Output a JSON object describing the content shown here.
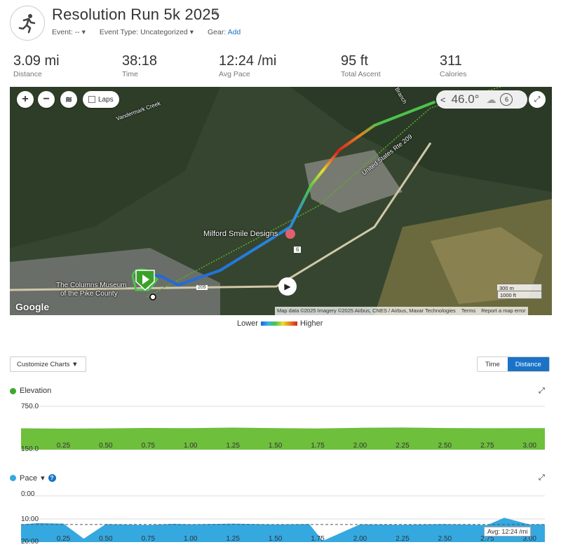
{
  "header": {
    "title": "Resolution Run 5k 2025",
    "event_label": "Event: --",
    "event_type_label": "Event Type: Uncategorized",
    "gear_label": "Gear:",
    "gear_link": "Add"
  },
  "stats": [
    {
      "value": "3.09 mi",
      "label": "Distance"
    },
    {
      "value": "38:18",
      "label": "Time"
    },
    {
      "value": "12:24 /mi",
      "label": "Avg Pace"
    },
    {
      "value": "95 ft",
      "label": "Total Ascent"
    },
    {
      "value": "311",
      "label": "Calories"
    }
  ],
  "map": {
    "laps_label": "Laps",
    "weather_temp": "46.0°",
    "weather_wind": "6",
    "labels": {
      "poi": "Milford Smile Designs",
      "museum_line1": "The Columns Museum",
      "museum_line2": "of the Pike County",
      "highway": "United States Rte 209",
      "route6": "6",
      "route209": "209",
      "creek": "Vandermark Creek",
      "branch": "Branch"
    },
    "google": "Google",
    "attribution": "Map data ©2025 Imagery ©2025 Airbus, CNES / Airbus, Maxar Technologies",
    "terms": "Terms",
    "report": "Report a map error",
    "scale_m": "300 m",
    "scale_ft": "1000 ft"
  },
  "legend": {
    "lower": "Lower",
    "higher": "Higher"
  },
  "controls": {
    "customize": "Customize Charts",
    "time": "Time",
    "distance": "Distance"
  },
  "colors": {
    "elevation": "#6ebf3c",
    "pace": "#35a8e0",
    "accent": "#1a73c7"
  },
  "chart_data": [
    {
      "type": "area",
      "title": "Elevation",
      "ylim": [
        150.0,
        750.0
      ],
      "y_tick_labels": [
        "750.0",
        "150.0"
      ],
      "x_tick_labels": [
        "0.25",
        "0.50",
        "0.75",
        "1.00",
        "1.25",
        "1.50",
        "1.75",
        "2.00",
        "2.25",
        "2.50",
        "2.75",
        "3.00"
      ],
      "x": [
        0,
        0.25,
        0.5,
        0.75,
        1.0,
        1.25,
        1.5,
        1.75,
        2.0,
        2.25,
        2.5,
        2.75,
        3.0,
        3.09
      ],
      "values": [
        445,
        440,
        444,
        450,
        447,
        455,
        448,
        443,
        452,
        456,
        449,
        446,
        448,
        447
      ]
    },
    {
      "type": "area",
      "title": "Pace",
      "ylim": [
        0,
        20
      ],
      "y_tick_labels": [
        "0:00",
        "10:00",
        "20:00"
      ],
      "x_tick_labels": [
        "0.25",
        "0.50",
        "0.75",
        "1.00",
        "1.25",
        "1.50",
        "1.75",
        "2.00",
        "2.25",
        "2.50",
        "2.75",
        "3.00"
      ],
      "x": [
        0,
        0.1,
        0.25,
        0.37,
        0.5,
        0.75,
        0.9,
        1.0,
        1.25,
        1.5,
        1.7,
        1.78,
        2.0,
        2.25,
        2.5,
        2.75,
        2.85,
        3.0,
        3.09
      ],
      "values": [
        12.3,
        11.8,
        12.0,
        18.5,
        12.2,
        12.6,
        12.1,
        12.3,
        12.0,
        12.4,
        12.2,
        19.5,
        12.3,
        12.5,
        12.2,
        12.6,
        9.5,
        12.4,
        12.3
      ],
      "avg_label": "Avg: 12:24 /mi",
      "avg": 12.4
    }
  ]
}
